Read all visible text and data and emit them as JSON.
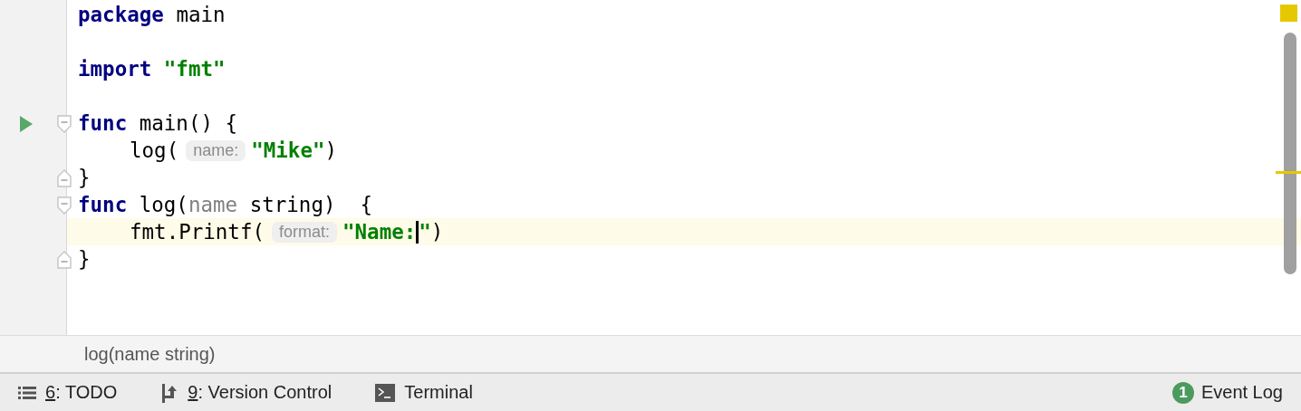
{
  "editor": {
    "lines": [
      {
        "indented": false,
        "current": false,
        "run": false,
        "fold_start": false,
        "fold_end": false,
        "tokens": [
          {
            "kind": "keyword",
            "text": "package"
          },
          {
            "kind": "plain",
            "text": "main"
          }
        ]
      },
      {
        "current": false,
        "run": false,
        "fold_start": false,
        "fold_end": false
      },
      {
        "indented": false,
        "current": false,
        "run": false,
        "fold_start": false,
        "fold_end": false,
        "tokens": [
          {
            "kind": "keyword",
            "text": "import"
          },
          {
            "kind": "string",
            "text": "\"fmt\""
          }
        ]
      },
      {
        "current": false,
        "run": false,
        "fold_start": false,
        "fold_end": false
      },
      {
        "indented": false,
        "current": false,
        "run": true,
        "fold_start": true,
        "fold_end": false,
        "tokens": [
          {
            "kind": "keyword",
            "text": "func"
          },
          {
            "kind": "plain",
            "text": "main() {"
          }
        ]
      },
      {
        "indented": true,
        "current": false,
        "run": false,
        "fold_start": false,
        "fold_end": false,
        "tokens": [
          {
            "kind": "plain",
            "text": "log("
          },
          {
            "kind": "hint",
            "text": "name:"
          },
          {
            "kind": "string",
            "text": "\"Mike\""
          },
          {
            "kind": "plain",
            "text": ")"
          }
        ]
      },
      {
        "indented": false,
        "current": false,
        "run": false,
        "fold_start": false,
        "fold_end": true,
        "tokens": [
          {
            "kind": "plain",
            "text": "}"
          }
        ]
      },
      {
        "indented": false,
        "current": false,
        "run": false,
        "fold_start": true,
        "fold_end": false,
        "tokens": [
          {
            "kind": "keyword",
            "text": "func"
          },
          {
            "kind": "plain",
            "text": "log("
          },
          {
            "kind": "param",
            "text": "name"
          },
          {
            "kind": "plain",
            "text": " string)  {"
          }
        ]
      },
      {
        "indented": true,
        "current": true,
        "run": false,
        "fold_start": false,
        "fold_end": false,
        "tokens": [
          {
            "kind": "plain",
            "text": "fmt.Printf("
          },
          {
            "kind": "hint",
            "text": "format:"
          },
          {
            "kind": "string",
            "text": "\"Name:"
          },
          {
            "kind": "cursor"
          },
          {
            "kind": "string",
            "text": "\""
          },
          {
            "kind": "plain",
            "text": ")"
          }
        ]
      },
      {
        "indented": false,
        "current": false,
        "run": false,
        "fold_start": false,
        "fold_end": true,
        "tokens": [
          {
            "kind": "plain",
            "text": "}"
          }
        ]
      }
    ]
  },
  "signature_hint": "log(name string)",
  "status_bar": {
    "tools": [
      {
        "kind": "list",
        "mnemonic": "6",
        "label": ": TODO"
      },
      {
        "kind": "vcs",
        "mnemonic": "9",
        "label": ": Version Control"
      },
      {
        "kind": "terminal",
        "label": "Terminal"
      }
    ],
    "event_log": {
      "count": "1",
      "label": "Event Log"
    }
  }
}
